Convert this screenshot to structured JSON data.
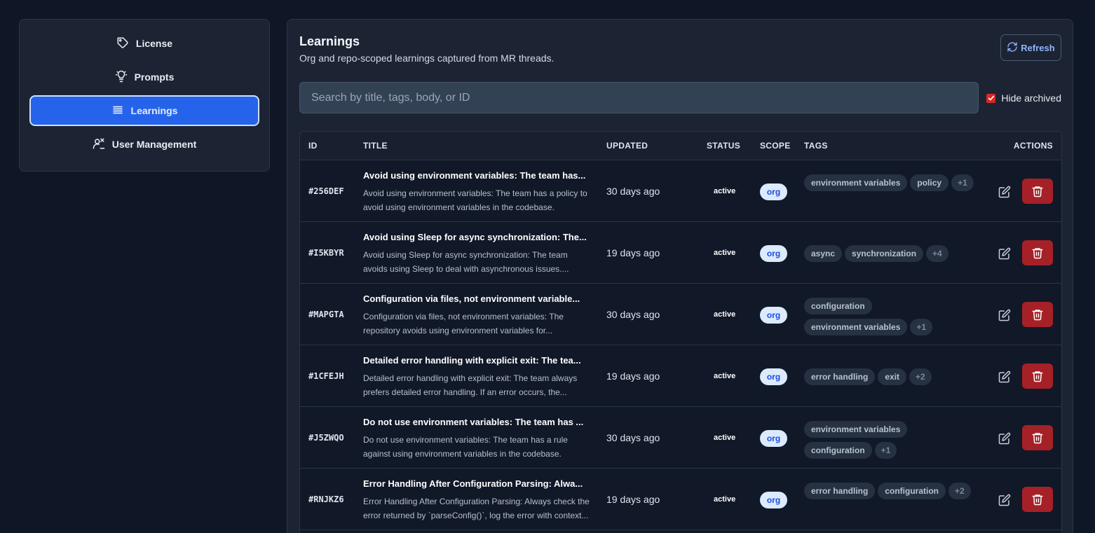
{
  "sidebar": {
    "items": [
      {
        "label": "License",
        "icon": "tag-icon"
      },
      {
        "label": "Prompts",
        "icon": "lightbulb-icon"
      },
      {
        "label": "Learnings",
        "icon": "list-icon",
        "active": true
      },
      {
        "label": "User Management",
        "icon": "user-settings-icon"
      }
    ]
  },
  "panel": {
    "title": "Learnings",
    "subtitle": "Org and repo-scoped learnings captured from MR threads.",
    "refresh_label": "Refresh",
    "search_placeholder": "Search by title, tags, body, or ID",
    "hide_archived_label": "Hide archived",
    "hide_archived_checked": true
  },
  "table": {
    "headers": {
      "id": "ID",
      "title": "TITLE",
      "updated": "UPDATED",
      "status": "STATUS",
      "scope": "SCOPE",
      "tags": "TAGS",
      "actions": "ACTIONS"
    },
    "rows": [
      {
        "id": "#256DEF",
        "title": "Avoid using environment variables: The team has...",
        "body": "Avoid using environment variables: The team has a policy to avoid using environment variables in the codebase.",
        "updated": "30 days ago",
        "status": "active",
        "scope": "org",
        "tags": [
          "environment variables",
          "policy"
        ],
        "more": "+1"
      },
      {
        "id": "#I5KBYR",
        "title": "Avoid using Sleep for async synchronization: The...",
        "body": "Avoid using Sleep for async synchronization: The team avoids using Sleep to deal with asynchronous issues....",
        "updated": "19 days ago",
        "status": "active",
        "scope": "org",
        "tags": [
          "async",
          "synchronization"
        ],
        "more": "+4"
      },
      {
        "id": "#MAPGTA",
        "title": "Configuration via files, not environment variable...",
        "body": "Configuration via files, not environment variables: The repository avoids using environment variables for...",
        "updated": "30 days ago",
        "status": "active",
        "scope": "org",
        "tags": [
          "configuration",
          "environment variables"
        ],
        "more": "+1"
      },
      {
        "id": "#1CFEJH",
        "title": "Detailed error handling with explicit exit: The tea...",
        "body": "Detailed error handling with explicit exit: The team always prefers detailed error handling. If an error occurs, the...",
        "updated": "19 days ago",
        "status": "active",
        "scope": "org",
        "tags": [
          "error handling",
          "exit"
        ],
        "more": "+2"
      },
      {
        "id": "#J5ZWQO",
        "title": "Do not use environment variables: The team has ...",
        "body": "Do not use environment variables: The team has a rule against using environment variables in the codebase.",
        "updated": "30 days ago",
        "status": "active",
        "scope": "org",
        "tags": [
          "environment variables",
          "configuration"
        ],
        "more": "+1"
      },
      {
        "id": "#RNJKZ6",
        "title": "Error Handling After Configuration Parsing: Alwa...",
        "body": "Error Handling After Configuration Parsing: Always check the error returned by `parseConfig()`, log the error with context...",
        "updated": "19 days ago",
        "status": "active",
        "scope": "org",
        "tags": [
          "error handling",
          "configuration"
        ],
        "more": "+2"
      }
    ]
  }
}
